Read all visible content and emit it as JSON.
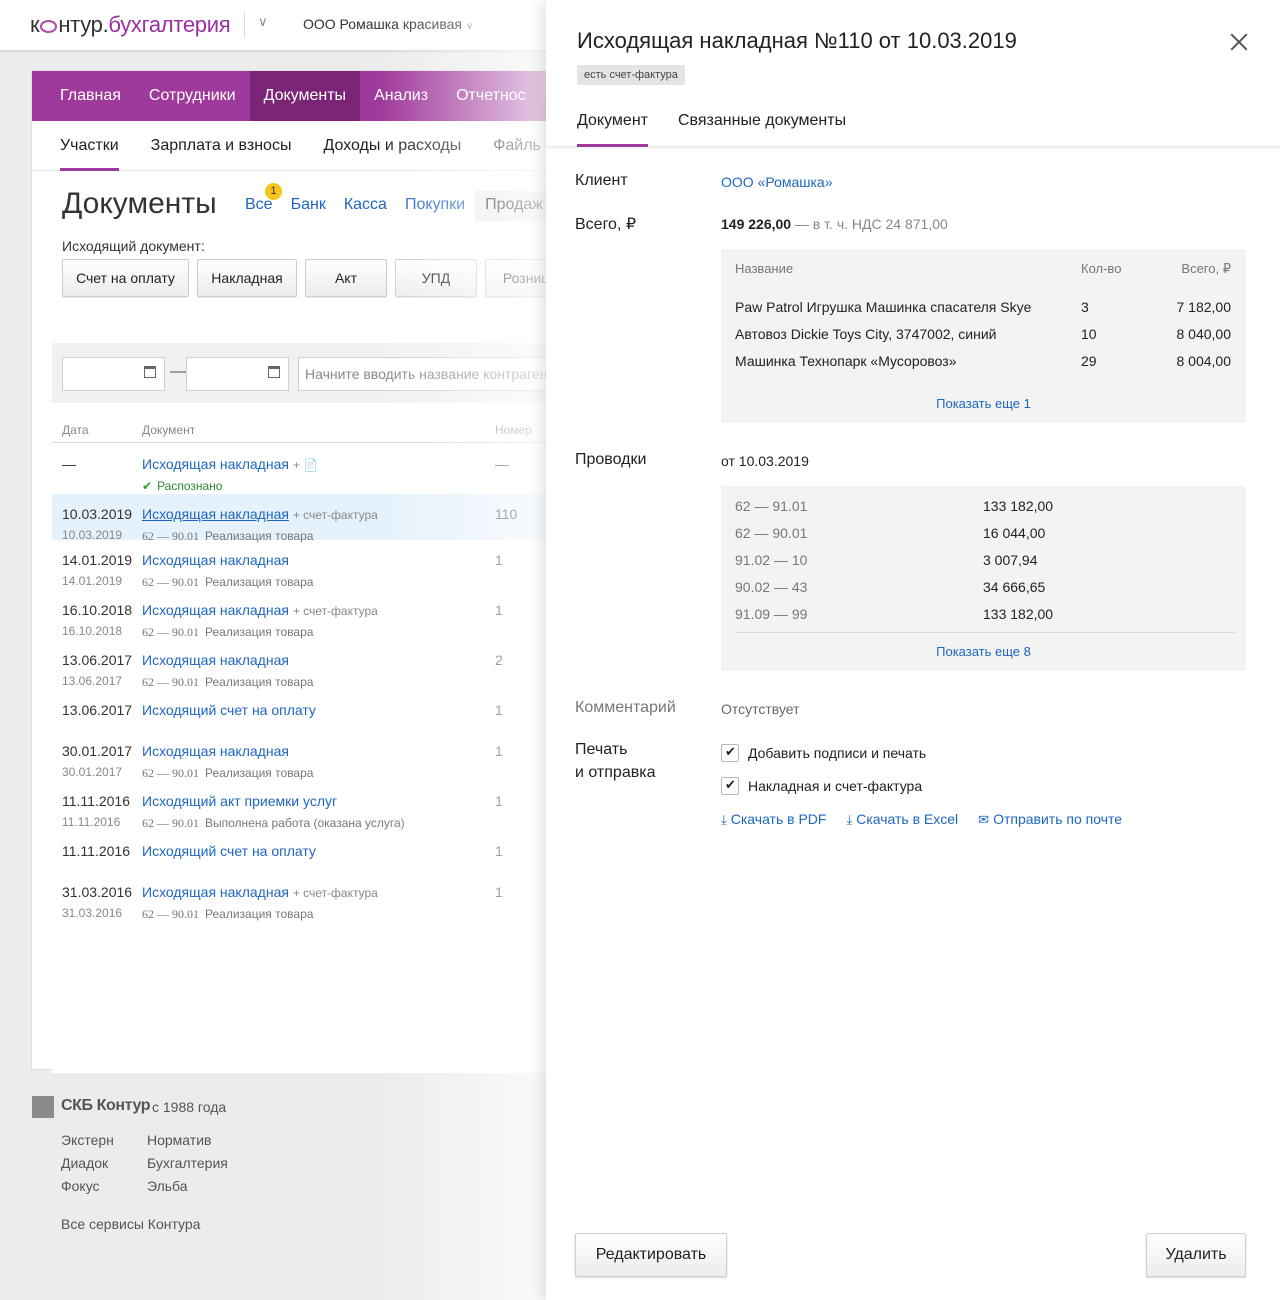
{
  "topbar": {
    "logo_k": "к",
    "logo_rest": "нтур",
    "logo_dot": ".",
    "logo_brand": "бухгалтерия",
    "org": "ООО Ромашка красивая"
  },
  "mainnav": [
    "Главная",
    "Сотрудники",
    "Документы",
    "Анализ",
    "Отчетнос"
  ],
  "subnav": [
    "Участки",
    "Зарплата и взносы",
    "Доходы и расходы",
    "Файль"
  ],
  "page": {
    "title": "Документы",
    "filters": [
      "Все",
      "Банк",
      "Касса",
      "Покупки",
      "Продаж"
    ],
    "badge": "1",
    "out_label": "Исходящий документ:",
    "out_buttons": [
      "Счет на оплату",
      "Накладная",
      "Акт",
      "УПД",
      "Розница"
    ],
    "search_placeholder": "Начните вводить название контрагента"
  },
  "table": {
    "headers": [
      "Дата",
      "Документ",
      "Номер"
    ],
    "rows": [
      {
        "date": "—",
        "date2": "",
        "doc": "Исходящая накладная",
        "extra": "+ 📄",
        "acc": "",
        "desc": "",
        "num": "—",
        "status": "Распознано"
      },
      {
        "date": "10.03.2019",
        "date2": "10.03.2019",
        "doc": "Исходящая накладная",
        "extra": "+ счет-фактура",
        "acc": "62 — 90.01",
        "desc": "Реализация товара",
        "num": "110",
        "status": ""
      },
      {
        "date": "14.01.2019",
        "date2": "14.01.2019",
        "doc": "Исходящая накладная",
        "extra": "",
        "acc": "62 — 90.01",
        "desc": "Реализация товара",
        "num": "1",
        "status": ""
      },
      {
        "date": "16.10.2018",
        "date2": "16.10.2018",
        "doc": "Исходящая накладная",
        "extra": "+ счет-фактура",
        "acc": "62 — 90.01",
        "desc": "Реализация товара",
        "num": "1",
        "status": ""
      },
      {
        "date": "13.06.2017",
        "date2": "13.06.2017",
        "doc": "Исходящая накладная",
        "extra": "",
        "acc": "62 — 90.01",
        "desc": "Реализация товара",
        "num": "2",
        "status": ""
      },
      {
        "date": "13.06.2017",
        "date2": "",
        "doc": "Исходящий счет на оплату",
        "extra": "",
        "acc": "",
        "desc": "",
        "num": "1",
        "status": ""
      },
      {
        "date": "30.01.2017",
        "date2": "30.01.2017",
        "doc": "Исходящая накладная",
        "extra": "",
        "acc": "62 — 90.01",
        "desc": "Реализация товара",
        "num": "1",
        "status": ""
      },
      {
        "date": "11.11.2016",
        "date2": "11.11.2016",
        "doc": "Исходящий акт приемки услуг",
        "extra": "",
        "acc": "62 — 90.01",
        "desc": "Выполнена работа (оказана услуга)",
        "num": "1",
        "status": ""
      },
      {
        "date": "11.11.2016",
        "date2": "",
        "doc": "Исходящий счет на оплату",
        "extra": "",
        "acc": "",
        "desc": "",
        "num": "1",
        "status": ""
      },
      {
        "date": "31.03.2016",
        "date2": "31.03.2016",
        "doc": "Исходящая накладная",
        "extra": "+ счет-фактура",
        "acc": "62 — 90.01",
        "desc": "Реализация товара",
        "num": "1",
        "status": ""
      }
    ]
  },
  "footer": {
    "brand": "СКБ Контур",
    "since": "с 1988 года",
    "links_col1": [
      "Экстерн",
      "Диадок",
      "Фокус"
    ],
    "links_col2": [
      "Норматив",
      "Бухгалтерия",
      "Эльба"
    ],
    "all": "Все сервисы Контура"
  },
  "panel": {
    "title": "Исходящая накладная №110 от 10.03.2019",
    "tag": "есть счет-фактура",
    "tabs": [
      "Документ",
      "Связанные документы"
    ],
    "client_label": "Клиент",
    "client_value": "ООО «Ромашка»",
    "total_label": "Всего, ₽",
    "total_value": "149 226,00",
    "total_vat": "— в т. ч. НДС 24 871,00",
    "items_headers": [
      "Название",
      "Кол-во",
      "Всего, ₽"
    ],
    "items": [
      {
        "name": "Paw Patrol Игрушка Машинка спасателя Skye",
        "qty": "3",
        "sum": "7 182,00"
      },
      {
        "name": "Автовоз Dickie Toys City, 3747002, синий",
        "qty": "10",
        "sum": "8 040,00"
      },
      {
        "name": "Машинка Технопарк «Мусоровоз»",
        "qty": "29",
        "sum": "8 004,00"
      }
    ],
    "items_more": "Показать еще 1",
    "postings_label": "Проводки",
    "postings_date": "от 10.03.2019",
    "postings": [
      {
        "acc": "62 — 91.01",
        "sum": "133 182,00"
      },
      {
        "acc": "62 — 90.01",
        "sum": "16 044,00"
      },
      {
        "acc": "91.02 — 10",
        "sum": "3 007,94"
      },
      {
        "acc": "90.02 — 43",
        "sum": "34 666,65"
      },
      {
        "acc": "91.09 — 99",
        "sum": "133 182,00"
      }
    ],
    "postings_more": "Показать еще 8",
    "comment_label": "Комментарий",
    "comment_value": "Отсутствует",
    "print_label_1": "Печать",
    "print_label_2": "и отправка",
    "check_1": "Добавить подписи и печать",
    "check_2": "Накладная и счет-фактура",
    "actions": [
      "Скачать в PDF",
      "Скачать в Excel",
      "Отправить по почте"
    ],
    "edit_button": "Редактировать",
    "delete_button": "Удалить"
  },
  "colors": {
    "brand_purple": "#a0399c",
    "nav_active": "#7c2478",
    "link_blue": "#1e66c2",
    "selected_row": "#e5f1fb",
    "badge_yellow": "#f5c51c",
    "ok_green": "#2e9e2e"
  },
  "icons": [
    "calendar-icon",
    "close-icon",
    "download-icon",
    "mail-icon",
    "check-icon",
    "chevron-down-icon",
    "attachment-icon",
    "kontur-logo-icon"
  ]
}
